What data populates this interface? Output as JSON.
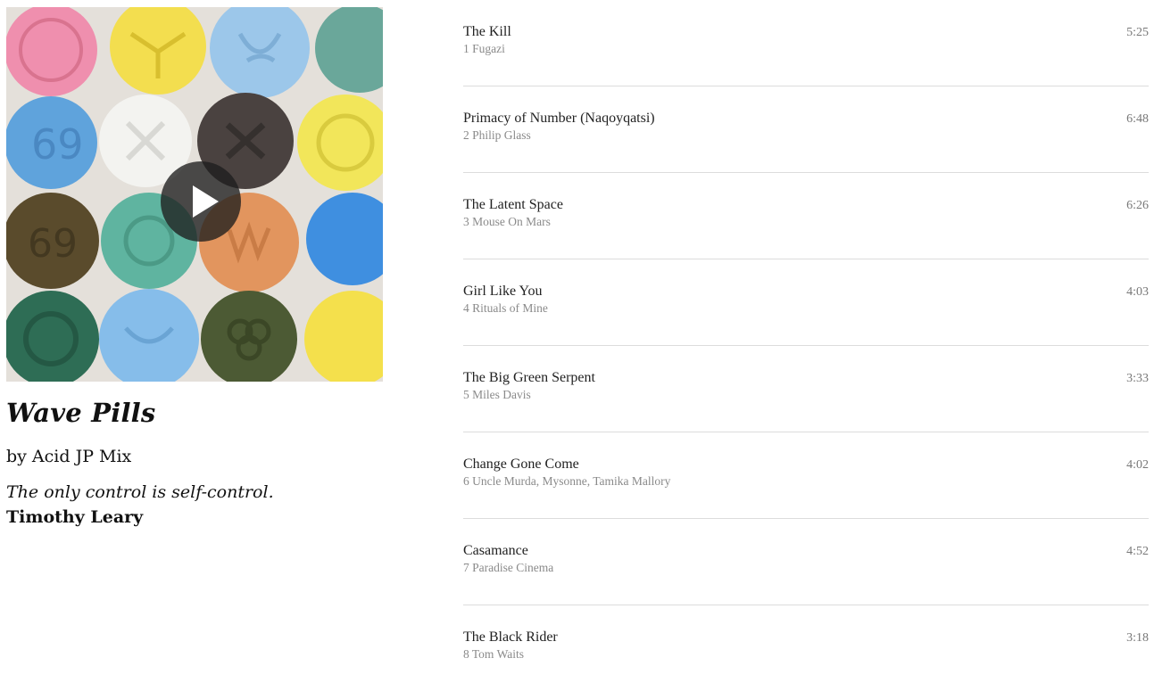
{
  "album": {
    "title": "Wave Pills",
    "byline": "by Acid JP Mix",
    "quote": "The only control is self-control.",
    "quote_author": "Timothy Leary",
    "cover_description_icon": "pill-pattern-cover"
  },
  "player": {
    "play_icon": "play-icon"
  },
  "tracks": [
    {
      "title": "The Kill",
      "number": "1",
      "artist": "Fugazi",
      "sub": "1 Fugazi",
      "duration": "5:25"
    },
    {
      "title": "Primacy of Number (Naqoyqatsi)",
      "number": "2",
      "artist": "Philip Glass",
      "sub": "2 Philip Glass",
      "duration": "6:48"
    },
    {
      "title": "The Latent Space",
      "number": "3",
      "artist": "Mouse On Mars",
      "sub": "3 Mouse On Mars",
      "duration": "6:26"
    },
    {
      "title": "Girl Like You",
      "number": "4",
      "artist": "Rituals of Mine",
      "sub": "4 Rituals of Mine",
      "duration": "4:03"
    },
    {
      "title": "The Big Green Serpent",
      "number": "5",
      "artist": "Miles Davis",
      "sub": "5 Miles Davis",
      "duration": "3:33"
    },
    {
      "title": "Change Gone Come",
      "number": "6",
      "artist": "Uncle Murda, Mysonne, Tamika Mallory",
      "sub": "6 Uncle Murda, Mysonne, Tamika Mallory",
      "duration": "4:02"
    },
    {
      "title": "Casamance",
      "number": "7",
      "artist": "Paradise Cinema",
      "sub": "7 Paradise Cinema",
      "duration": "4:52"
    },
    {
      "title": "The Black Rider",
      "number": "8",
      "artist": "Tom Waits",
      "sub": "8 Tom Waits",
      "duration": "3:18"
    }
  ]
}
